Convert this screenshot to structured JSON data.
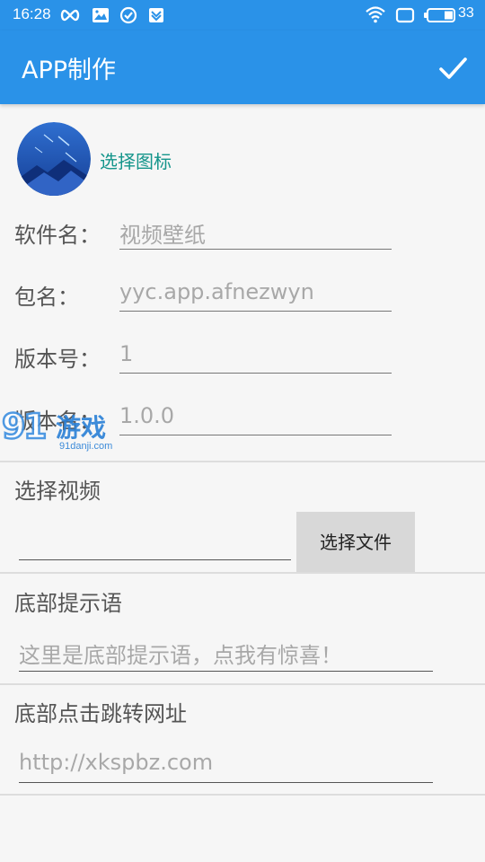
{
  "status_bar": {
    "time": "16:28",
    "battery": "33",
    "icons": [
      "infinity-icon",
      "image-icon",
      "check-circle-icon",
      "shield-icon",
      "wifi-icon",
      "screen-icon",
      "battery-icon"
    ]
  },
  "app_bar": {
    "title": "APP制作",
    "confirm_icon": "check-icon"
  },
  "icon_section": {
    "choose_icon_label": "选择图标"
  },
  "form": {
    "app_name_label": "软件名：",
    "app_name_value": "视频壁纸",
    "package_label": "包名：",
    "package_value": "yyc.app.afnezwyn",
    "version_code_label": "版本号：",
    "version_code_value": "1",
    "version_name_label": "版本名：",
    "version_name_value": "1.0.0"
  },
  "video_section": {
    "title": "选择视频",
    "file_path": "",
    "choose_file_button": "选择文件"
  },
  "bottom_hint_section": {
    "title": "底部提示语",
    "placeholder": "这里是底部提示语，点我有惊喜！"
  },
  "bottom_url_section": {
    "title": "底部点击跳转网址",
    "placeholder": "http://xkspbz.com"
  },
  "watermark": {
    "logo_text": "91游戏",
    "url": "91danji.com"
  },
  "colors": {
    "primary": "#2a92e8",
    "accent": "#14958b",
    "background": "#f6f6f6"
  }
}
